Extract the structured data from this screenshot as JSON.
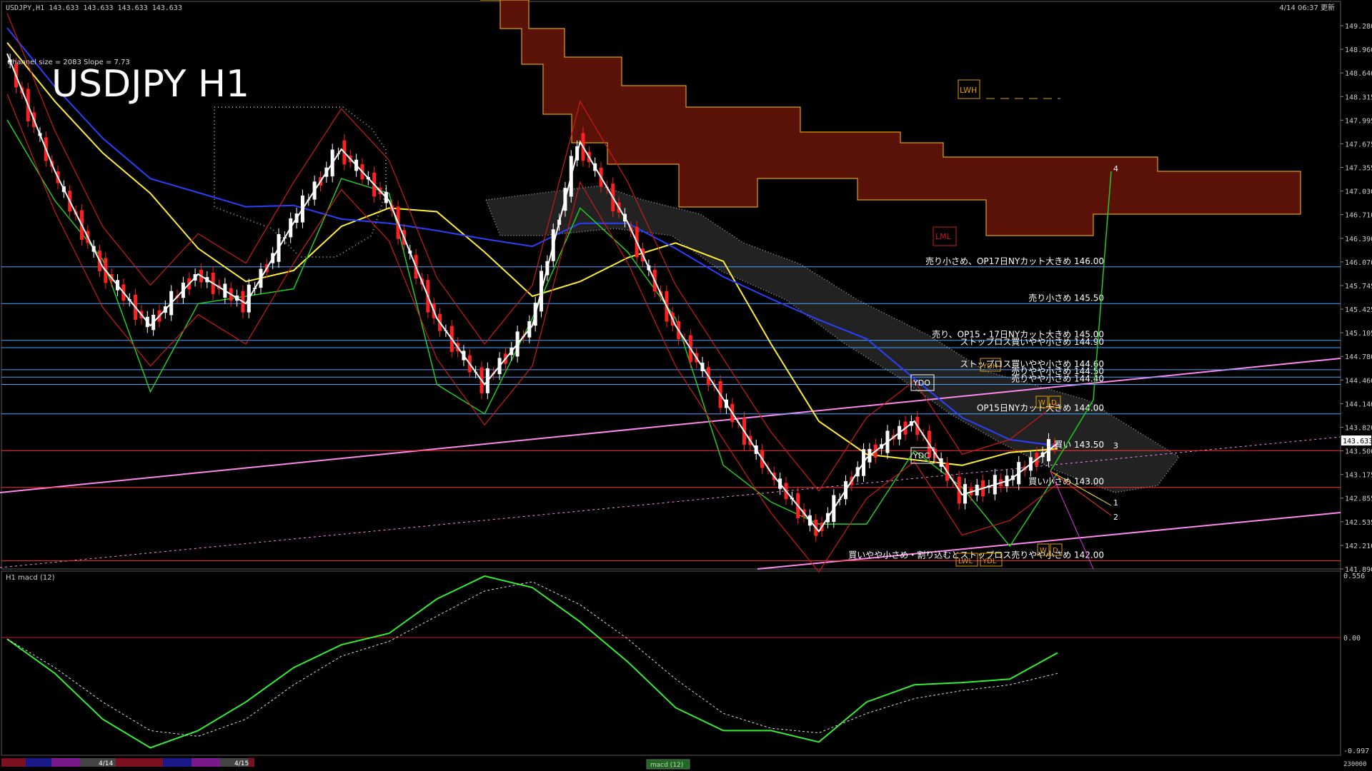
{
  "window": {
    "header_left": "USDJPY,H1  143.633 143.633 143.633 143.633",
    "header_right": "4/14 06:37 更新",
    "channel_info": "Channel size = 2083 Slope = 7.73",
    "big_title": "USDJPY H1"
  },
  "price_axis": {
    "labels": [
      "149.280",
      "148.960",
      "148.640",
      "148.315",
      "147.995",
      "147.675",
      "147.355",
      "147.030",
      "146.710",
      "146.390",
      "146.070",
      "145.745",
      "145.425",
      "145.105",
      "144.780",
      "144.460",
      "144.140",
      "143.820",
      "143.500",
      "143.175",
      "142.855",
      "142.535",
      "142.210",
      "141.890"
    ],
    "current_price": "143.633",
    "current_color": "#ffffff"
  },
  "level_annotations": [
    {
      "text": "売り小さめ、OP17日NYカット大きめ 146.00",
      "price": 146.0,
      "color": "#4aa3ff"
    },
    {
      "text": "売り小さめ 145.50",
      "price": 145.5,
      "color": "#4aa3ff"
    },
    {
      "text": "売り、OP15・17日NYカット大きめ 145.00",
      "price": 145.0,
      "color": "#4aa3ff"
    },
    {
      "text": "ストップロス買いやや小さめ 144.90",
      "price": 144.9,
      "color": "#4aa3ff"
    },
    {
      "text": "ストップロス買いやや小さめ 144.60",
      "price": 144.6,
      "color": "#4aa3ff"
    },
    {
      "text": "売りやや小さめ 144.50",
      "price": 144.5,
      "color": "#4aa3ff"
    },
    {
      "text": "売りやや小さめ 144.40",
      "price": 144.4,
      "color": "#4aa3ff"
    },
    {
      "text": "OP15日NYカット大きめ 144.00",
      "price": 144.0,
      "color": "#4aa3ff"
    },
    {
      "text": "買い 143.50",
      "price": 143.5,
      "color": "#ff3030"
    },
    {
      "text": "買い小さめ 143.00",
      "price": 143.0,
      "color": "#ff3030"
    },
    {
      "text": "買いやや小さめ・割り込むとストップロス売りやや小さめ 142.00",
      "price": 142.0,
      "color": "#ff3030"
    }
  ],
  "box_labels": {
    "lwh": "LWH",
    "lml": "LML",
    "ydh": "YDH",
    "ydo": "YDO",
    "ydc": "YDC",
    "lwl": "LWL",
    "ydl": "YDL",
    "w": "W",
    "d": "D",
    "wave_1": "1",
    "wave_2": "2",
    "wave_3": "3",
    "wave_4": "4"
  },
  "macd_panel": {
    "title": "H1  macd (12)",
    "axis_top": "0.556",
    "axis_zero": "0.00",
    "axis_bottom": "-0.997",
    "volume_label": "230000"
  },
  "bottom_bar": {
    "dates": [
      "4/14",
      "4/15"
    ],
    "tab_label": "macd (12)"
  },
  "chart_data": {
    "type": "line",
    "title": "USDJPY H1",
    "xlabel": "",
    "ylabel": "",
    "ylim": [
      141.89,
      149.28
    ],
    "x": [
      "4/14",
      "4/15"
    ],
    "series": [
      {
        "name": "USDJPY H1",
        "values": [
          148.9,
          147.3,
          146.0,
          145.2,
          145.9,
          145.5,
          146.6,
          147.6,
          146.9,
          145.3,
          144.4,
          145.2,
          147.7,
          146.6,
          145.2,
          144.2,
          143.2,
          142.4,
          143.4,
          143.9,
          142.9,
          143.1,
          143.6
        ]
      }
    ],
    "macd": {
      "ylim": [
        -0.997,
        0.556
      ],
      "main": [
        0.0,
        -0.3,
        -0.7,
        -0.95,
        -0.8,
        -0.55,
        -0.25,
        -0.05,
        0.05,
        0.35,
        0.55,
        0.45,
        0.15,
        -0.2,
        -0.6,
        -0.8,
        -0.8,
        -0.9,
        -0.55,
        -0.4,
        -0.38,
        -0.35,
        -0.12
      ],
      "signal": [
        0.0,
        -0.25,
        -0.55,
        -0.8,
        -0.85,
        -0.7,
        -0.4,
        -0.15,
        -0.02,
        0.2,
        0.42,
        0.5,
        0.3,
        0.0,
        -0.35,
        -0.65,
        -0.78,
        -0.82,
        -0.65,
        -0.52,
        -0.45,
        -0.4,
        -0.3
      ]
    }
  }
}
